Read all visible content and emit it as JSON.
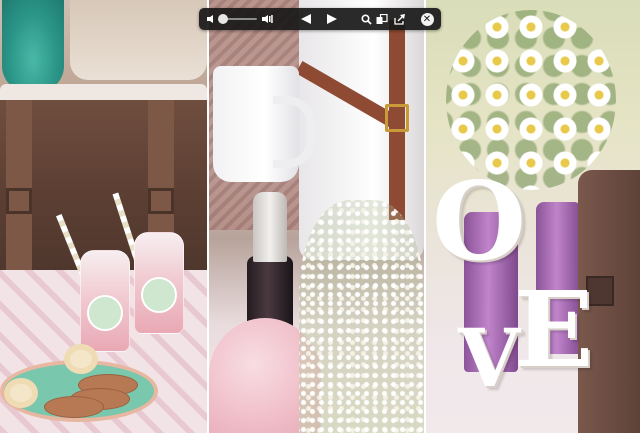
{
  "viewer": {
    "panel_count": 3
  },
  "toolbar": {
    "icons": {
      "volume_low": "speaker-quiet-icon",
      "volume_high": "speaker-loud-icon",
      "previous": "triangle-left-icon",
      "next": "triangle-right-icon",
      "zoom": "magnifier-icon",
      "index_sheet": "stacked-squares-icon",
      "share": "box-arrow-icon",
      "close": "x-circle-icon"
    },
    "volume_level": 0.1,
    "colors": {
      "background": "#181818",
      "icon": "#ffffff"
    }
  },
  "photos": {
    "panel3": {
      "letters": [
        "O",
        "V",
        "E"
      ]
    }
  }
}
